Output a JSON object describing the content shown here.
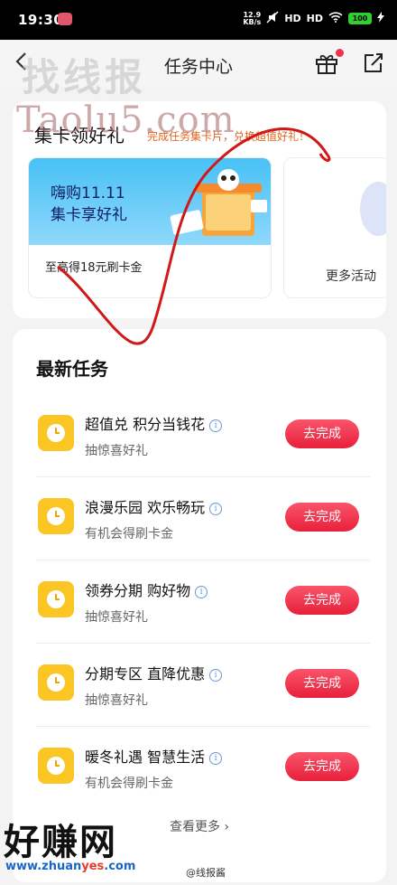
{
  "status_bar": {
    "time": "19:30",
    "net_speed_value": "12.9",
    "net_speed_unit": "KB/s",
    "signal_1": "HD",
    "signal_2": "HD",
    "battery": "100"
  },
  "header": {
    "title": "任务中心",
    "back_icon": "chevron-left-icon",
    "gift_icon": "gift-icon",
    "share_icon": "share-icon"
  },
  "watermarks": {
    "top": "找线报",
    "url": "Taolu5.com",
    "footer_big": "好赚网",
    "footer_url_prefix": "www.zhuan",
    "footer_url_mid": "yes",
    "footer_url_suffix": ".com",
    "handle": "@线报酱"
  },
  "card_collect": {
    "title": "集卡领好礼",
    "subtitle": "完成任务集卡片，兑换超值好礼！",
    "promo": {
      "line1": "嗨购11.11",
      "line2": "集卡享好礼",
      "caption": "至高得18元刷卡金"
    },
    "more_label": "更多活动"
  },
  "card_tasks": {
    "title": "最新任务",
    "tasks": [
      {
        "name": "超值兑 积分当钱花",
        "desc": "抽惊喜好礼",
        "button": "去完成"
      },
      {
        "name": "浪漫乐园 欢乐畅玩",
        "desc": "有机会得刷卡金",
        "button": "去完成"
      },
      {
        "name": "领券分期 购好物",
        "desc": "抽惊喜好礼",
        "button": "去完成"
      },
      {
        "name": "分期专区 直降优惠",
        "desc": "抽惊喜好礼",
        "button": "去完成"
      },
      {
        "name": "暖冬礼遇 智慧生活",
        "desc": "有机会得刷卡金",
        "button": "去完成"
      }
    ],
    "view_more": "查看更多 ›"
  },
  "colors": {
    "accent_red": "#e8203b",
    "task_icon_yellow": "#fbc524",
    "subtitle_orange": "#e0641e",
    "banner_blue": "#48c1f5"
  }
}
